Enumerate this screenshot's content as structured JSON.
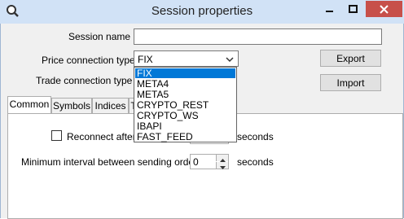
{
  "window": {
    "title": "Session properties",
    "icon": "magnifier-app-icon",
    "controls": [
      "minimize-icon",
      "maximize-icon",
      "close-icon"
    ]
  },
  "form": {
    "session_name_label": "Session name",
    "session_name_value": "",
    "price_connection_label": "Price connection type",
    "price_connection_value": "FIX",
    "trade_connection_label": "Trade connection type",
    "export_label": "Export",
    "import_label": "Import"
  },
  "dropdown": {
    "options": [
      "FIX",
      "META4",
      "META5",
      "CRYPTO_REST",
      "CRYPTO_WS",
      "IBAPI",
      "FAST_FEED"
    ],
    "selected": "FIX"
  },
  "tabs": [
    "Common",
    "Symbols",
    "Indices",
    "T"
  ],
  "common": {
    "reconnect_label": "Reconnect after n",
    "reconnect_checked": false,
    "reconnect_unit": "seconds",
    "min_interval_label": "Minimum interval between sending orders",
    "min_interval_value": "0",
    "min_interval_unit": "seconds"
  },
  "colors": {
    "titlebar": "#d1e2f6",
    "close_button": "#c7504a",
    "selection": "#0078d7",
    "dialog_bg": "#f0f0f0"
  }
}
